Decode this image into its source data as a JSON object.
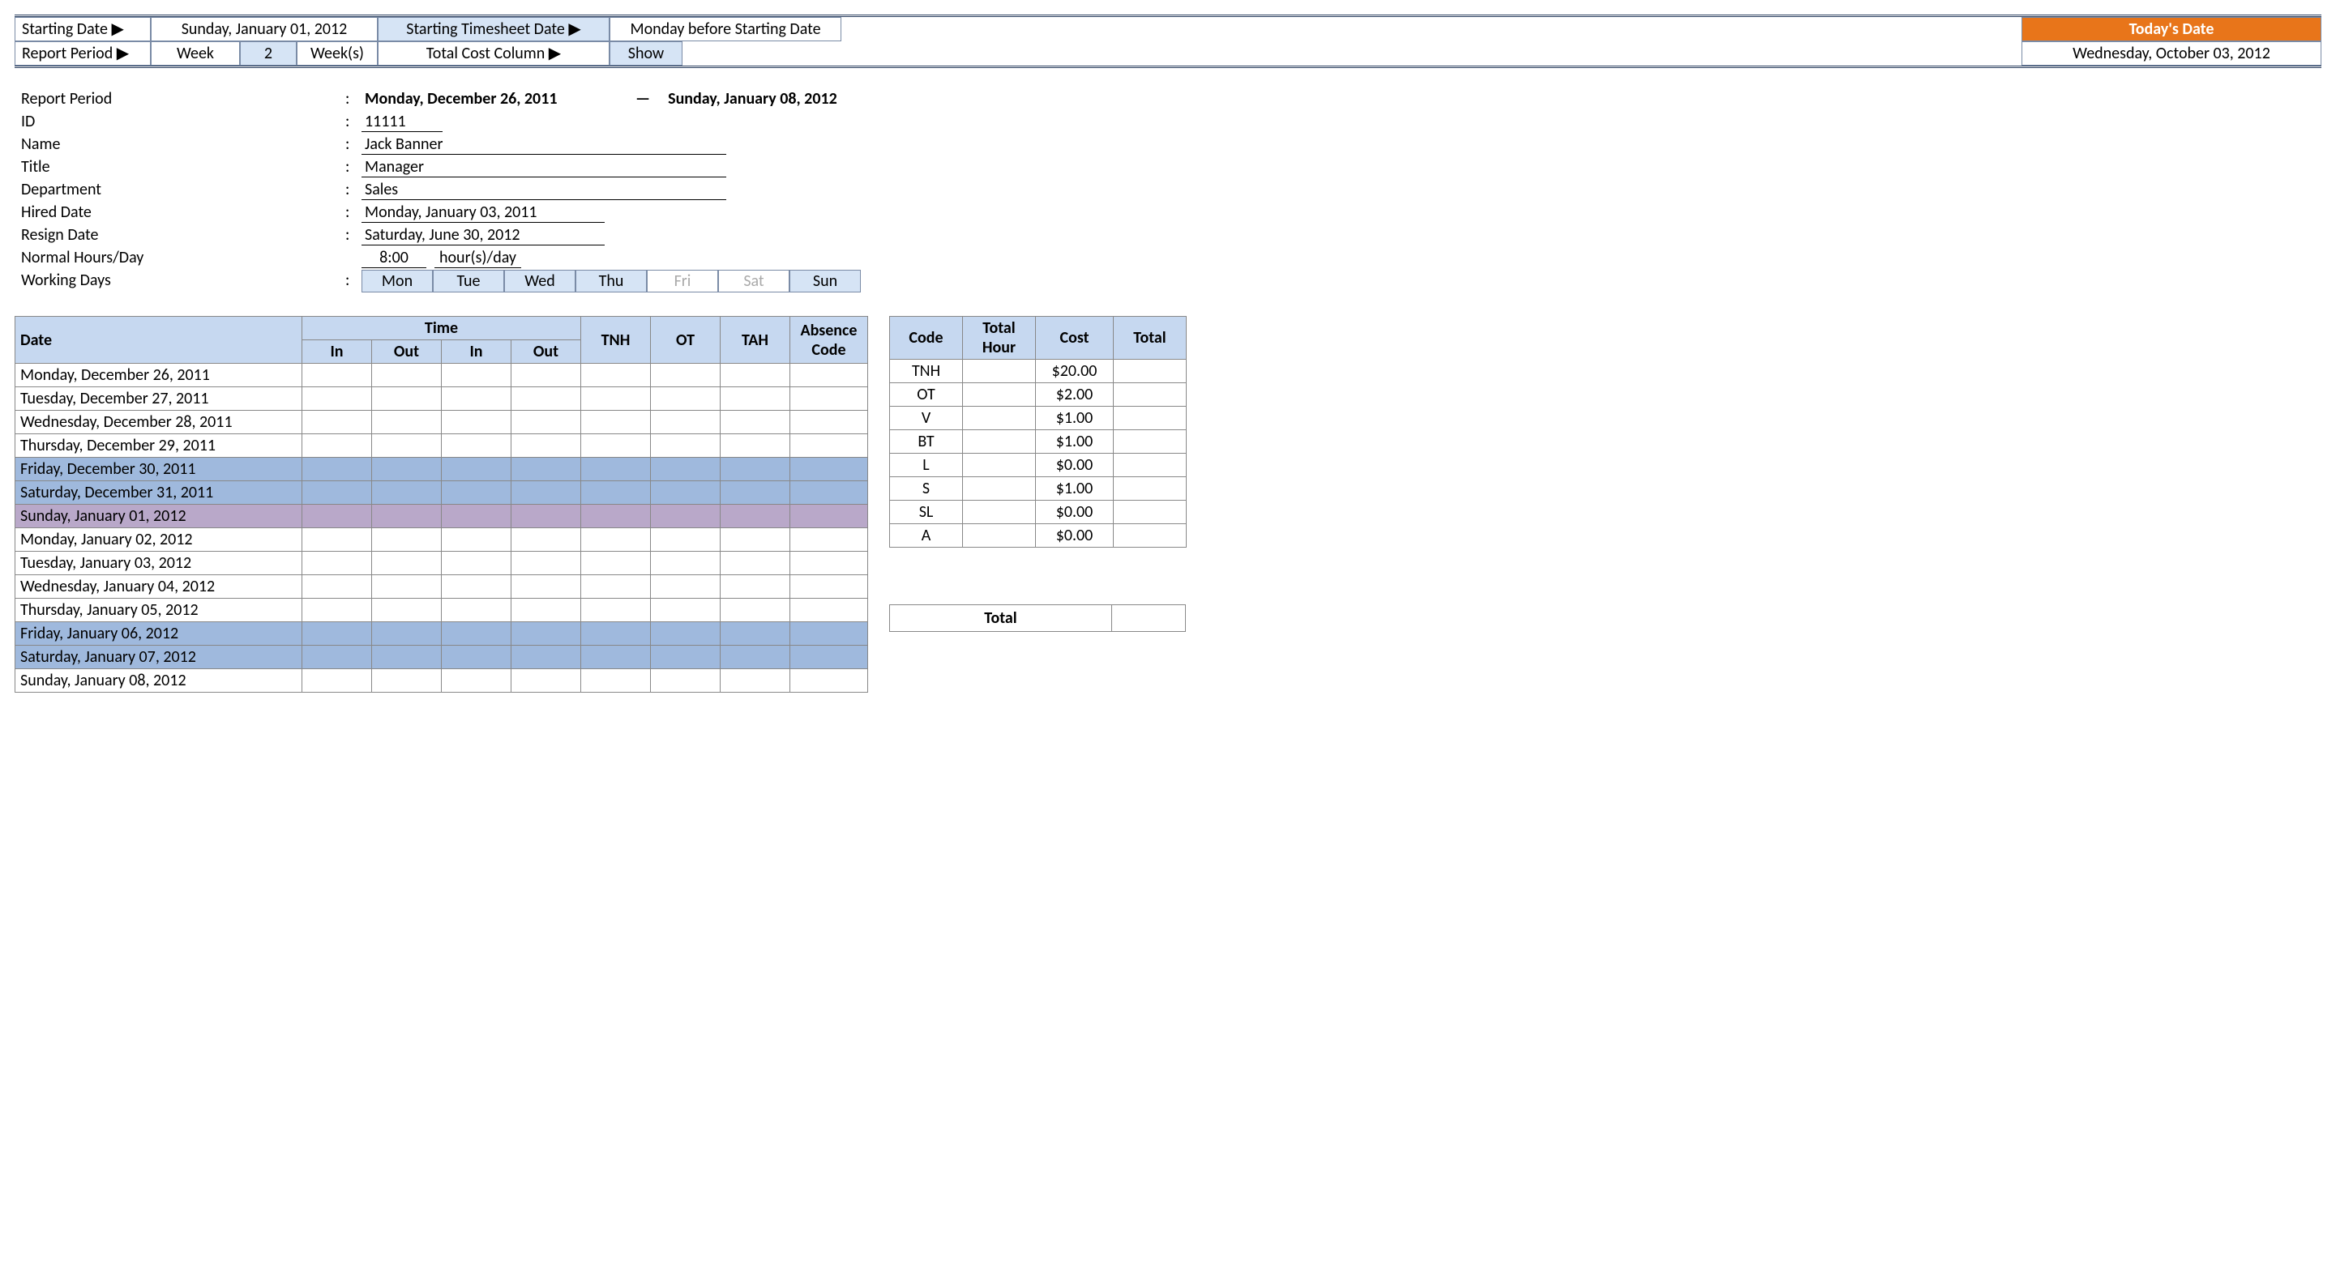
{
  "config": {
    "starting_date_label": "Starting Date ▶",
    "starting_date": "Sunday, January 01, 2012",
    "timesheet_date_label": "Starting Timesheet Date ▶",
    "timesheet_date": "Monday before Starting Date",
    "report_period_label": "Report Period ▶",
    "week_label": "Week",
    "week_count": "2",
    "week_unit": "Week(s)",
    "cost_col_label": "Total Cost Column ▶",
    "cost_col_value": "Show",
    "today_label": "Today's Date",
    "today_value": "Wednesday, October 03, 2012"
  },
  "info": {
    "report_period_label": "Report Period",
    "report_period_from": "Monday, December 26, 2011",
    "report_period_to": "Sunday, January 08, 2012",
    "dash": "—",
    "id_label": "ID",
    "id": "11111",
    "name_label": "Name",
    "name": "Jack Banner",
    "title_label": "Title",
    "title": "Manager",
    "dept_label": "Department",
    "dept": "Sales",
    "hired_label": "Hired Date",
    "hired": "Monday, January 03, 2011",
    "resign_label": "Resign Date",
    "resign": "Saturday, June 30, 2012",
    "normal_label": "Normal Hours/Day",
    "normal_hours": "8:00",
    "normal_unit": "hour(s)/day",
    "working_label": "Working Days",
    "days": [
      "Mon",
      "Tue",
      "Wed",
      "Thu",
      "Fri",
      "Sat",
      "Sun"
    ]
  },
  "ts_headers": {
    "date": "Date",
    "time": "Time",
    "in": "In",
    "out": "Out",
    "tnh": "TNH",
    "ot": "OT",
    "tah": "TAH",
    "abs": "Absence Code"
  },
  "ts_rows": [
    {
      "date": "Monday, December 26, 2011",
      "cls": ""
    },
    {
      "date": "Tuesday, December 27, 2011",
      "cls": ""
    },
    {
      "date": "Wednesday, December 28, 2011",
      "cls": ""
    },
    {
      "date": "Thursday, December 29, 2011",
      "cls": ""
    },
    {
      "date": "Friday, December 30, 2011",
      "cls": "wkend"
    },
    {
      "date": "Saturday, December 31, 2011",
      "cls": "wkend"
    },
    {
      "date": "Sunday, January 01, 2012",
      "cls": "wkend2"
    },
    {
      "date": "Monday, January 02, 2012",
      "cls": ""
    },
    {
      "date": "Tuesday, January 03, 2012",
      "cls": ""
    },
    {
      "date": "Wednesday, January 04, 2012",
      "cls": ""
    },
    {
      "date": "Thursday, January 05, 2012",
      "cls": ""
    },
    {
      "date": "Friday, January 06, 2012",
      "cls": "wkend"
    },
    {
      "date": "Saturday, January 07, 2012",
      "cls": "wkend"
    },
    {
      "date": "Sunday, January 08, 2012",
      "cls": ""
    }
  ],
  "codes_headers": {
    "code": "Code",
    "hour": "Total Hour",
    "cost": "Cost",
    "total": "Total"
  },
  "codes": [
    {
      "code": "TNH",
      "hour": "",
      "cost": "$20.00",
      "total": ""
    },
    {
      "code": "OT",
      "hour": "",
      "cost": "$2.00",
      "total": ""
    },
    {
      "code": "V",
      "hour": "",
      "cost": "$1.00",
      "total": ""
    },
    {
      "code": "BT",
      "hour": "",
      "cost": "$1.00",
      "total": ""
    },
    {
      "code": "L",
      "hour": "",
      "cost": "$0.00",
      "total": ""
    },
    {
      "code": "S",
      "hour": "",
      "cost": "$1.00",
      "total": ""
    },
    {
      "code": "SL",
      "hour": "",
      "cost": "$0.00",
      "total": ""
    },
    {
      "code": "A",
      "hour": "",
      "cost": "$0.00",
      "total": ""
    }
  ],
  "grand_total_label": "Total",
  "colon": ":"
}
